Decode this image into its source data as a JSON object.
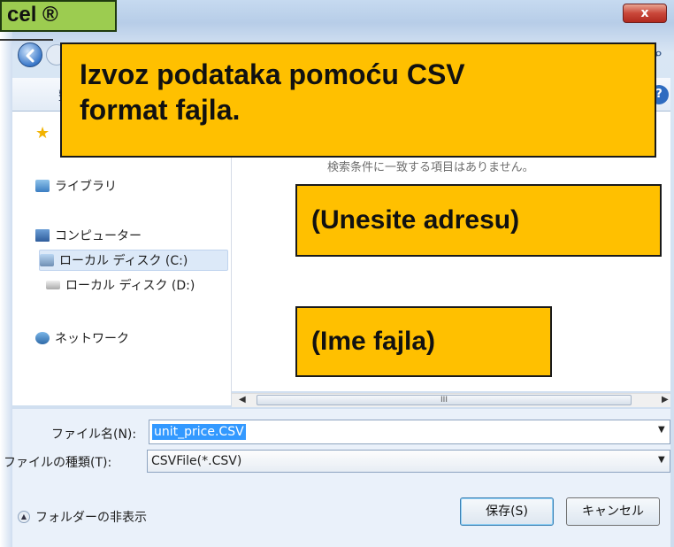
{
  "background": {
    "slide_title_fragment": "cel ®"
  },
  "window": {
    "close_label": "x"
  },
  "toolbar": {
    "organize_label": "整理",
    "help_label": "?"
  },
  "nav_pane": {
    "items": [
      {
        "label": "ライブラリ",
        "icon": "library-icon"
      },
      {
        "label": "コンピューター",
        "icon": "computer-icon"
      },
      {
        "label": "ローカル ディスク (C:)",
        "icon": "drive-c-icon",
        "selected": true
      },
      {
        "label": "ローカル ディスク (D:)",
        "icon": "drive-d-icon"
      },
      {
        "label": "ネットワーク",
        "icon": "network-icon"
      }
    ]
  },
  "content": {
    "empty_message": "検索条件に一致する項目はありません。",
    "scroll_thumb_grip": "III"
  },
  "form": {
    "filename_label": "ファイル名(N):",
    "filename_value": "unit_price.CSV",
    "filetype_label": "ファイルの種類(T):",
    "filetype_value": "CSVFile(*.CSV)",
    "hide_folders_label": "フォルダーの非表示",
    "save_label": "保存(S)",
    "cancel_label": "キャンセル"
  },
  "callouts": {
    "export_line1": "Izvoz podataka pomoću CSV",
    "export_line2": "format fajla.",
    "address": "(Unesite adresu)",
    "filename": "(Ime fajla)"
  },
  "colors": {
    "callout": "#ffc000",
    "slide_title_bg": "#9ccc50",
    "close_button": "#c9473a",
    "selection": "#3399ff"
  }
}
